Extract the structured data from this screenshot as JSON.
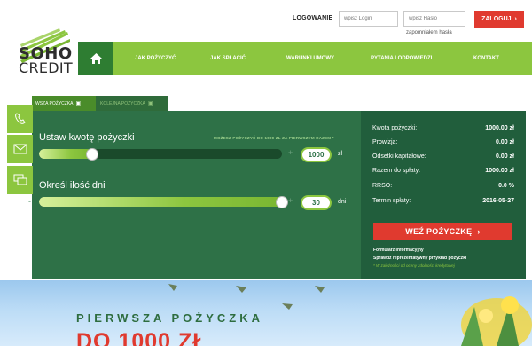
{
  "brand": {
    "line1": "SOHO",
    "line2": "CREDIT"
  },
  "login": {
    "label": "LOGOWANIE",
    "login_placeholder": "wpisz Login",
    "password_placeholder": "wpisz Hasło",
    "forgot": "zapomniałem hasła",
    "button": "ZALOGUJ"
  },
  "nav": {
    "items": [
      "JAK POŻYCZYĆ",
      "JAK SPŁACIĆ",
      "WARUNKI UMOWY",
      "PYTANIA I ODPOWIEDZI",
      "KONTAKT"
    ]
  },
  "tabs": {
    "active": "WSZA POŻYCZKA",
    "inactive": "KOLEJNA POŻYCZKA"
  },
  "calculator": {
    "amount_title": "Ustaw kwotę pożyczki",
    "amount_note": "MOŻESZ POŻYCZYĆ DO 1000 ZŁ ZA PIERWSZYM RAZEM *",
    "amount_value": "1000",
    "amount_unit": "zł",
    "amount_fill": 0.22,
    "days_title": "Określ ilość dni",
    "days_value": "30",
    "days_unit": "dni",
    "days_fill": 1.0,
    "minus": "-",
    "plus": "+"
  },
  "summary": {
    "rows": [
      {
        "label": "Kwota pożyczki:",
        "value": "1000.00 zł"
      },
      {
        "label": "Prowizja:",
        "value": "0.00 zł"
      },
      {
        "label": "Odsetki kapitałowe:",
        "value": "0.00 zł"
      },
      {
        "label": "Razem do spłaty:",
        "value": "1000.00 zł"
      },
      {
        "label": "RRSO:",
        "value": "0.0 %"
      },
      {
        "label": "Termin spłaty:",
        "value": "2016-05-27"
      }
    ],
    "cta": "WEŹ POŻYCZKĘ",
    "link1": "Formularz informacyjny",
    "link2": "Sprawdź reprezentatywny przykład pożyczki",
    "note": "* W zależności od oceny zdolności kredytowej"
  },
  "banner": {
    "subtitle": "PIERWSZA POŻYCZKA",
    "headline": "DO 1000 ZŁ"
  },
  "colors": {
    "green": "#8cc63f",
    "dark_green": "#2e7147",
    "red": "#e03a2f"
  }
}
